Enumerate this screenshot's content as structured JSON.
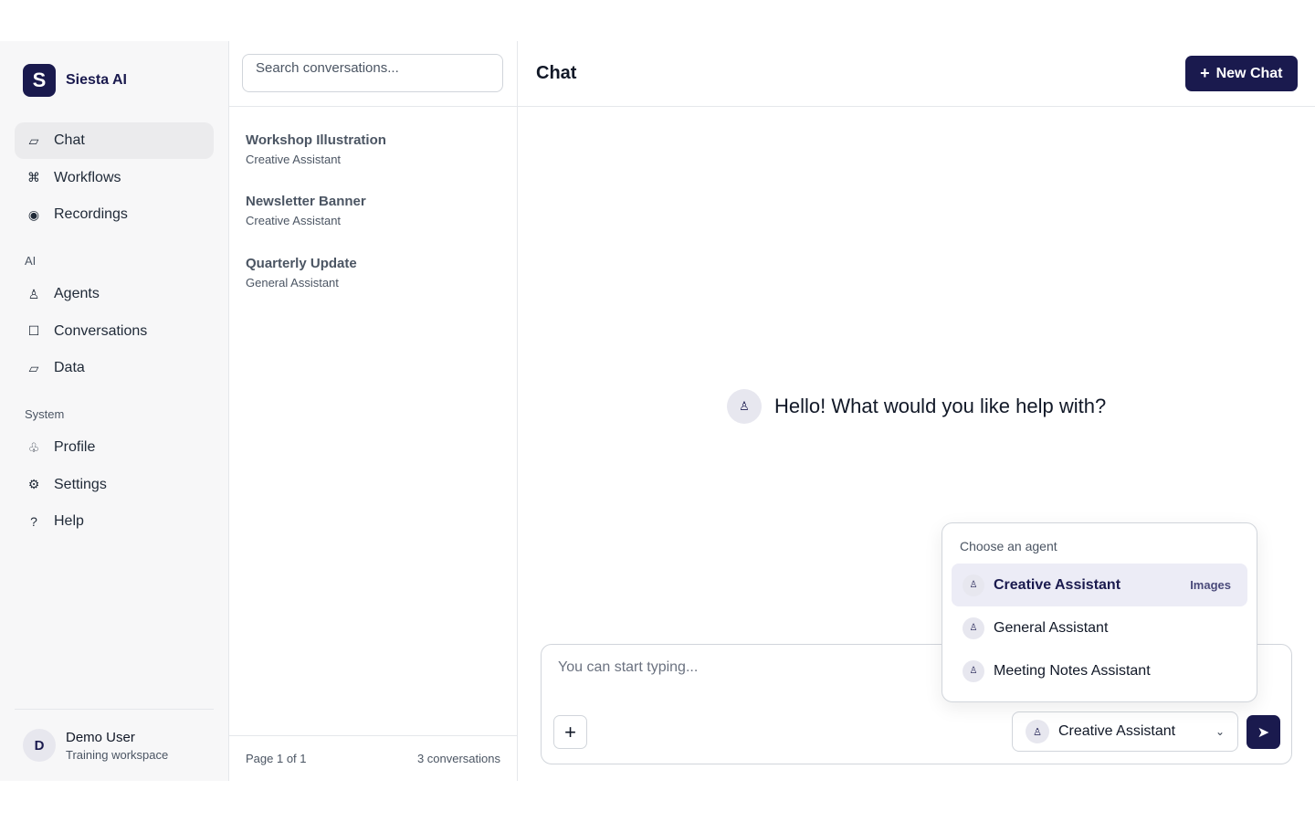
{
  "brand": {
    "logo_letter": "S",
    "name": "Siesta AI"
  },
  "nav": {
    "main": [
      {
        "label": "Chat",
        "icon": "▱"
      },
      {
        "label": "Workflows",
        "icon": "⌘"
      },
      {
        "label": "Recordings",
        "icon": "◉"
      }
    ],
    "ai_section": "AI",
    "ai": [
      {
        "label": "Agents",
        "icon": "♙"
      },
      {
        "label": "Conversations",
        "icon": "☐"
      },
      {
        "label": "Data",
        "icon": "▱"
      }
    ],
    "system_section": "System",
    "system": [
      {
        "label": "Profile",
        "icon": "♧"
      },
      {
        "label": "Settings",
        "icon": "⚙"
      },
      {
        "label": "Help",
        "icon": "?"
      }
    ]
  },
  "user": {
    "initial": "D",
    "name": "Demo User",
    "workspace": "Training workspace"
  },
  "conversations": {
    "search_placeholder": "Search conversations...",
    "items": [
      {
        "title": "Workshop Illustration",
        "agent": "Creative Assistant"
      },
      {
        "title": "Newsletter Banner",
        "agent": "Creative Assistant"
      },
      {
        "title": "Quarterly Update",
        "agent": "General Assistant"
      }
    ],
    "page": "Page 1 of 1",
    "count": "3 conversations"
  },
  "main": {
    "title": "Chat",
    "new_chat_label": "New Chat",
    "greeting": "Hello! What would you like help with?",
    "composer_placeholder": "You can start typing...",
    "selected_agent": "Creative Assistant"
  },
  "agent_dropdown": {
    "heading": "Choose an agent",
    "options": [
      {
        "label": "Creative Assistant",
        "badge": "Images"
      },
      {
        "label": "General Assistant",
        "badge": ""
      },
      {
        "label": "Meeting Notes Assistant",
        "badge": ""
      }
    ]
  },
  "colors": {
    "brand": "#1a1a4e",
    "sidebar_bg": "#f7f7f8",
    "selected_option_bg": "#ececf6"
  }
}
